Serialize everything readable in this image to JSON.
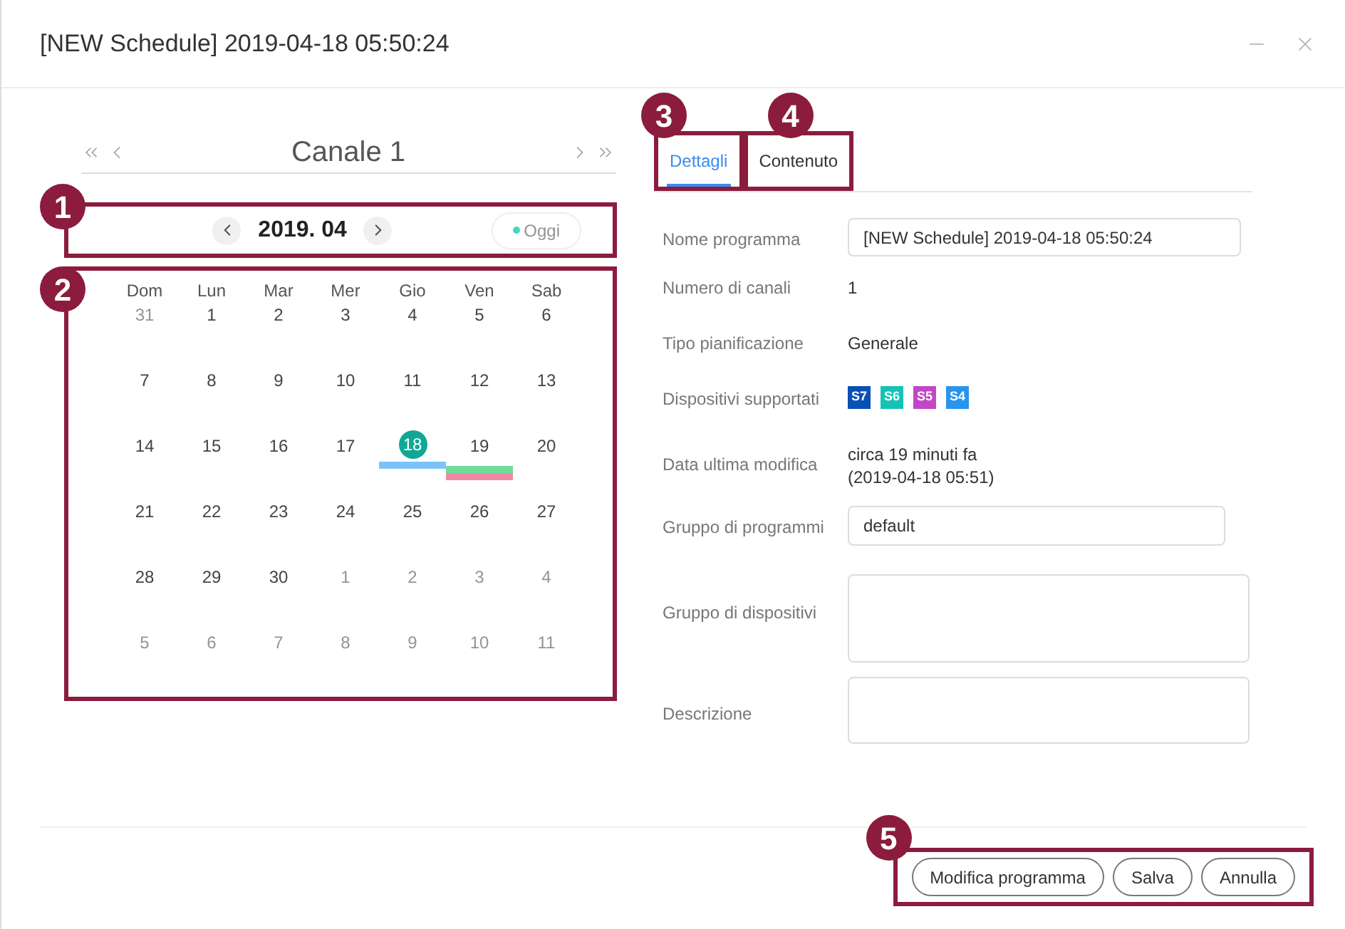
{
  "window": {
    "title": "[NEW Schedule] 2019-04-18 05:50:24"
  },
  "calendar": {
    "channel": "Canale 1",
    "month": "2019. 04",
    "today_button": "Oggi",
    "callout_month": "1",
    "callout_grid": "2",
    "weekdays": [
      "Dom",
      "Lun",
      "Mar",
      "Mer",
      "Gio",
      "Ven",
      "Sab"
    ],
    "weeks": [
      [
        {
          "day": "31",
          "muted": true,
          "selected": false
        },
        {
          "day": "1",
          "muted": false,
          "selected": false
        },
        {
          "day": "2",
          "muted": false,
          "selected": false
        },
        {
          "day": "3",
          "muted": false,
          "selected": false
        },
        {
          "day": "4",
          "muted": false,
          "selected": false
        },
        {
          "day": "5",
          "muted": false,
          "selected": false
        },
        {
          "day": "6",
          "muted": false,
          "selected": false
        }
      ],
      [
        {
          "day": "7",
          "muted": false,
          "selected": false
        },
        {
          "day": "8",
          "muted": false,
          "selected": false
        },
        {
          "day": "9",
          "muted": false,
          "selected": false
        },
        {
          "day": "10",
          "muted": false,
          "selected": false
        },
        {
          "day": "11",
          "muted": false,
          "selected": false
        },
        {
          "day": "12",
          "muted": false,
          "selected": false
        },
        {
          "day": "13",
          "muted": false,
          "selected": false
        }
      ],
      [
        {
          "day": "14",
          "muted": false,
          "selected": false
        },
        {
          "day": "15",
          "muted": false,
          "selected": false
        },
        {
          "day": "16",
          "muted": false,
          "selected": false
        },
        {
          "day": "17",
          "muted": false,
          "selected": false
        },
        {
          "day": "18",
          "muted": false,
          "selected": true,
          "events": [
            {
              "color": "#7cc4f8"
            }
          ]
        },
        {
          "day": "19",
          "muted": false,
          "selected": false,
          "events": [
            {
              "color": "#6fdc9c"
            },
            {
              "color": "#f08aa2"
            }
          ]
        },
        {
          "day": "20",
          "muted": false,
          "selected": false
        }
      ],
      [
        {
          "day": "21",
          "muted": false,
          "selected": false
        },
        {
          "day": "22",
          "muted": false,
          "selected": false
        },
        {
          "day": "23",
          "muted": false,
          "selected": false
        },
        {
          "day": "24",
          "muted": false,
          "selected": false
        },
        {
          "day": "25",
          "muted": false,
          "selected": false
        },
        {
          "day": "26",
          "muted": false,
          "selected": false
        },
        {
          "day": "27",
          "muted": false,
          "selected": false
        }
      ],
      [
        {
          "day": "28",
          "muted": false,
          "selected": false
        },
        {
          "day": "29",
          "muted": false,
          "selected": false
        },
        {
          "day": "30",
          "muted": false,
          "selected": false
        },
        {
          "day": "1",
          "muted": true,
          "selected": false
        },
        {
          "day": "2",
          "muted": true,
          "selected": false
        },
        {
          "day": "3",
          "muted": true,
          "selected": false
        },
        {
          "day": "4",
          "muted": true,
          "selected": false
        }
      ],
      [
        {
          "day": "5",
          "muted": true,
          "selected": false
        },
        {
          "day": "6",
          "muted": true,
          "selected": false
        },
        {
          "day": "7",
          "muted": true,
          "selected": false
        },
        {
          "day": "8",
          "muted": true,
          "selected": false
        },
        {
          "day": "9",
          "muted": true,
          "selected": false
        },
        {
          "day": "10",
          "muted": true,
          "selected": false
        },
        {
          "day": "11",
          "muted": true,
          "selected": false
        }
      ]
    ]
  },
  "tabs": [
    {
      "label": "Dettagli",
      "selected": true,
      "callout": "3"
    },
    {
      "label": "Contenuto",
      "selected": false,
      "callout": "4"
    }
  ],
  "form": [
    {
      "kind": "input",
      "label": "Nome programma",
      "value": "[NEW Schedule] 2019-04-18 05:50:24"
    },
    {
      "kind": "text",
      "label": "Numero di canali",
      "value": "1"
    },
    {
      "kind": "text",
      "label": "Tipo pianificazione",
      "value": "Generale"
    },
    {
      "kind": "devices",
      "label": "Dispositivi supportati",
      "devices": [
        {
          "name": "S7",
          "color": "#0a4fb4"
        },
        {
          "name": "S6",
          "color": "#14c3b5"
        },
        {
          "name": "S5",
          "color": "#c247c6"
        },
        {
          "name": "S4",
          "color": "#2a93ee"
        }
      ]
    },
    {
      "kind": "multiline",
      "label": "Data ultima modifica",
      "lines": [
        "circa 19 minuti fa",
        "(2019-04-18 05:51)"
      ]
    },
    {
      "kind": "select",
      "label": "Gruppo di programmi",
      "value": "default"
    },
    {
      "kind": "textarea",
      "label": "Gruppo di dispositivi"
    },
    {
      "kind": "textarea_small",
      "label": "Descrizione"
    }
  ],
  "footer": {
    "callout": "5",
    "buttons": [
      "Modifica programma",
      "Salva",
      "Annulla"
    ]
  }
}
